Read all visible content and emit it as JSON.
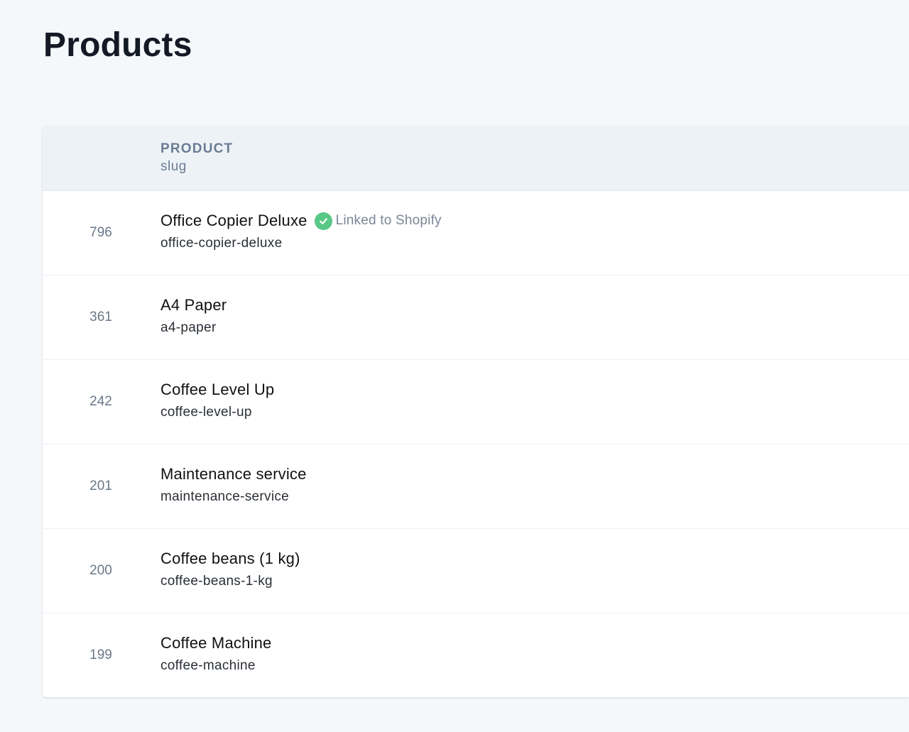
{
  "page": {
    "title": "Products"
  },
  "table": {
    "header": {
      "product": "PRODUCT",
      "slug": "slug"
    },
    "rows": [
      {
        "id": "796",
        "name": "Office Copier Deluxe",
        "slug": "office-copier-deluxe",
        "badge": "Linked to Shopify",
        "badge_icon": "check-circle-icon"
      },
      {
        "id": "361",
        "name": "A4 Paper",
        "slug": "a4-paper"
      },
      {
        "id": "242",
        "name": "Coffee Level Up",
        "slug": "coffee-level-up"
      },
      {
        "id": "201",
        "name": "Maintenance service",
        "slug": "maintenance-service"
      },
      {
        "id": "200",
        "name": "Coffee beans (1 kg)",
        "slug": "coffee-beans-1-kg"
      },
      {
        "id": "199",
        "name": "Coffee Machine",
        "slug": "coffee-machine"
      }
    ]
  },
  "colors": {
    "background": "#f5f8fb",
    "header_bg": "#edf2f7",
    "badge_green": "#58c886",
    "muted_text": "#6b7c93"
  }
}
